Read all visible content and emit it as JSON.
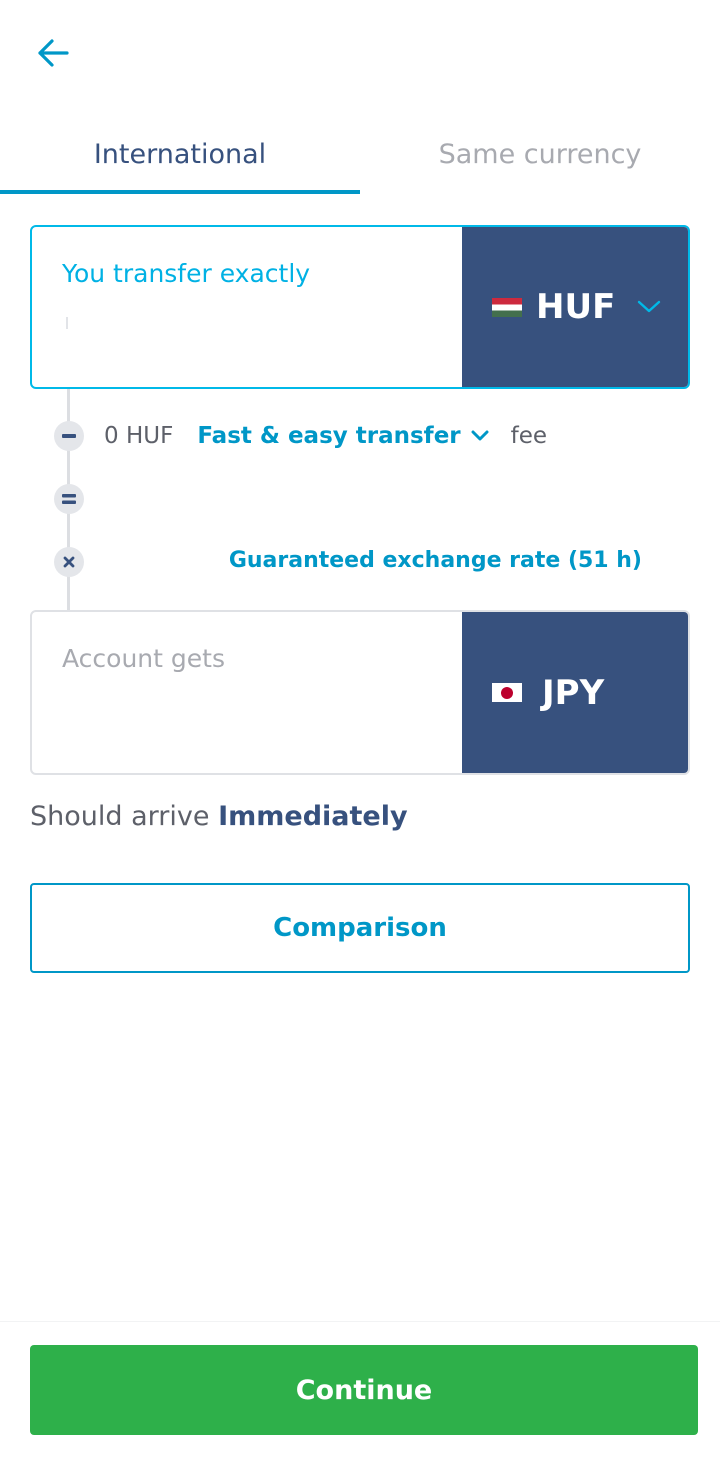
{
  "header": {
    "back_icon": "arrow-left-icon"
  },
  "tabs": [
    {
      "label": "International",
      "active": true
    },
    {
      "label": "Same currency",
      "active": false
    }
  ],
  "send": {
    "label": "You transfer exactly",
    "currency": "HUF",
    "flag": "hungary-flag-icon",
    "dropdown_icon": "chevron-down-icon"
  },
  "fee": {
    "amount": "0 HUF",
    "type": "Fast & easy transfer",
    "suffix": "fee"
  },
  "rate": {
    "label": "Guaranteed exchange rate (51 h)"
  },
  "receive": {
    "label": "Account gets",
    "currency": "JPY",
    "flag": "japan-flag-icon"
  },
  "arrival": {
    "prefix": "Should arrive",
    "value": "Immediately"
  },
  "comparison": {
    "label": "Comparison"
  },
  "continue": {
    "label": "Continue"
  },
  "colors": {
    "accent": "#0097c7",
    "navy": "#37517e",
    "primary_button": "#2eb04a"
  }
}
